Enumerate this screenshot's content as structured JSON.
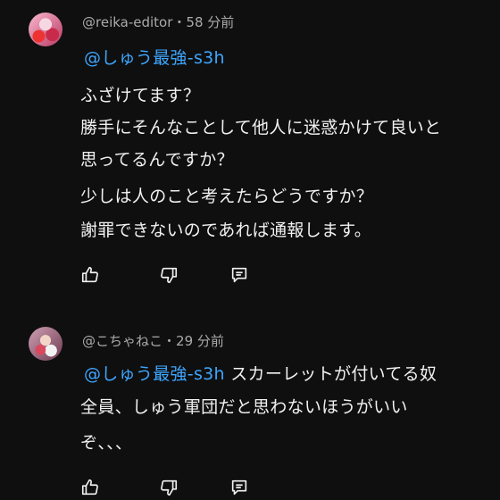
{
  "comments": [
    {
      "author": "@reika-editor",
      "separator": "・",
      "time": "58 分前",
      "mention": "@しゅう最強-s3h",
      "lines": [
        "ふざけてます？",
        "勝手にそんなことして他人に迷惑かけて良いと",
        "思ってるんですか？",
        "少しは人のこと考えたらどうですか？",
        "謝罪できないのであれば通報します。"
      ],
      "icons": [
        "thumbs-up-icon",
        "thumbs-down-icon",
        "reply-icon"
      ]
    },
    {
      "author": "@こちゃねこ",
      "separator": "・",
      "time": "29 分前",
      "mention": "@しゅう最強-s3h",
      "first_line_rest": " スカーレットが付いてる奴",
      "lines": [
        "全員、しゅう軍団だと思わないほうがいい",
        "ぞ、、、"
      ],
      "icons": [
        "thumbs-up-icon",
        "thumbs-down-icon",
        "reply-icon"
      ]
    }
  ],
  "colors": {
    "background": "#0f0f0f",
    "text": "#f1f1f1",
    "meta": "#aaaaaa",
    "mention": "#3ea6ff"
  }
}
